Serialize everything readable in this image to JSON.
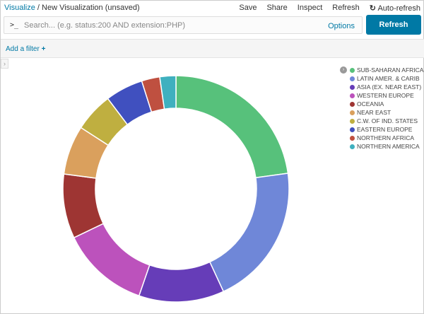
{
  "breadcrumb": {
    "root": "Visualize",
    "sep": "/",
    "current": "New Visualization (unsaved)"
  },
  "menu": [
    "Save",
    "Share",
    "Inspect",
    "Refresh",
    "Auto-refresh"
  ],
  "search": {
    "prompt": ">_",
    "placeholder": "Search... (e.g. status:200 AND extension:PHP)",
    "options": "Options"
  },
  "refresh_button": "Refresh",
  "filter": {
    "add_label": "Add a filter",
    "plus": "+"
  },
  "chart_data": {
    "type": "pie",
    "donut": true,
    "unit": "percent of total",
    "legend_position": "top-right",
    "categories": [
      "SUB-SAHARAN AFRICA",
      "LATIN AMER. & CARIB",
      "ASIA (EX. NEAR EAST)",
      "WESTERN EUROPE",
      "OCEANIA",
      "NEAR EAST",
      "C.W. OF IND. STATES",
      "EASTERN EUROPE",
      "NORTHERN AFRICA",
      "NORTHERN AMERICA"
    ],
    "values": [
      22.8,
      20.3,
      12.2,
      12.6,
      9.2,
      7.0,
      5.6,
      5.4,
      2.6,
      2.3
    ],
    "colors": [
      "#57c17b",
      "#6f87d8",
      "#663db8",
      "#bc52bc",
      "#9e3533",
      "#daa05d",
      "#bfaf40",
      "#4050bf",
      "#bf5040",
      "#3fb0bf"
    ]
  }
}
